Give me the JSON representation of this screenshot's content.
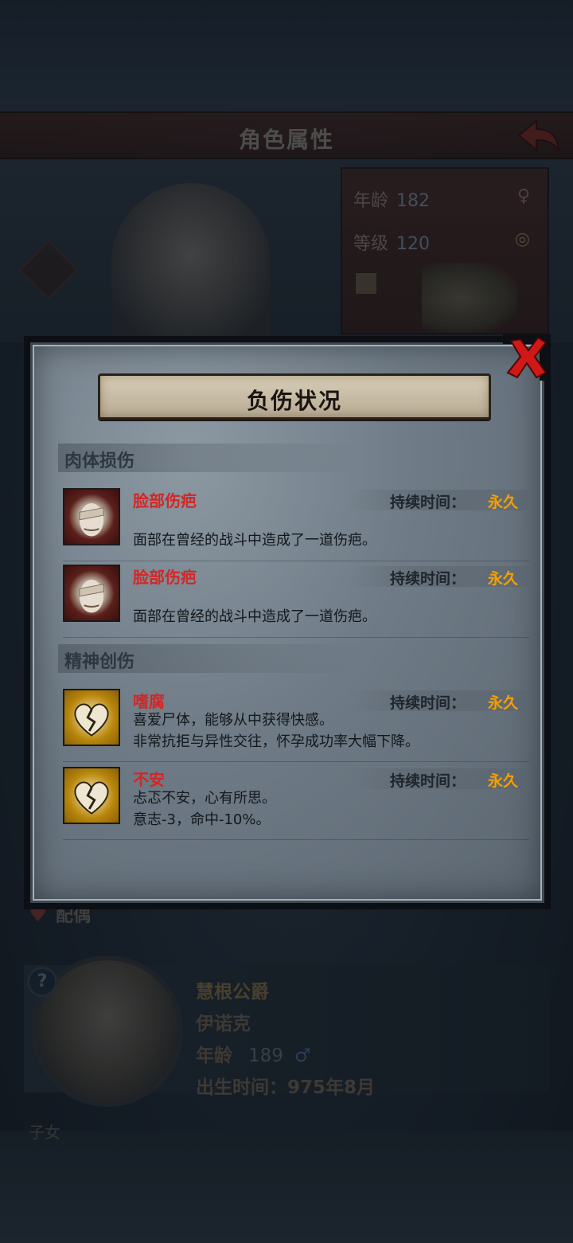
{
  "background": {
    "title": "角色属性",
    "stats": {
      "age_label": "年龄",
      "age_value": "182",
      "level_label": "等级",
      "level_value": "120"
    },
    "spouse": {
      "section_label": "配偶",
      "title": "慧根公爵",
      "name": "伊诺克",
      "age_label": "年龄",
      "age_value": "189",
      "birth_label": "出生时间：975年8月"
    },
    "children_label": "子女"
  },
  "modal": {
    "title": "负伤状况",
    "sections": [
      {
        "label": "肉体损伤",
        "items": [
          {
            "name": "脸部伤疤",
            "duration_label": "持续时间：",
            "duration": "永久",
            "desc": "面部在曾经的战斗中造成了一道伤疤。",
            "icon": "scarred-face-icon"
          },
          {
            "name": "脸部伤疤",
            "duration_label": "持续时间：",
            "duration": "永久",
            "desc": "面部在曾经的战斗中造成了一道伤疤。",
            "icon": "scarred-face-icon"
          }
        ]
      },
      {
        "label": "精神创伤",
        "items": [
          {
            "name": "嗜腐",
            "duration_label": "持续时间：",
            "duration": "永久",
            "desc": "喜爱尸体，能够从中获得快感。\n非常抗拒与异性交往，怀孕成功率大幅下降。",
            "icon": "broken-heart-icon"
          },
          {
            "name": "不安",
            "duration_label": "持续时间：",
            "duration": "永久",
            "desc": "忐忑不安，心有所思。\n意志-3，命中-10%。",
            "icon": "broken-heart-icon"
          }
        ]
      }
    ]
  },
  "colors": {
    "injury_name": "#d32626",
    "duration_value": "#f5a000",
    "close_x": "#d01818"
  }
}
